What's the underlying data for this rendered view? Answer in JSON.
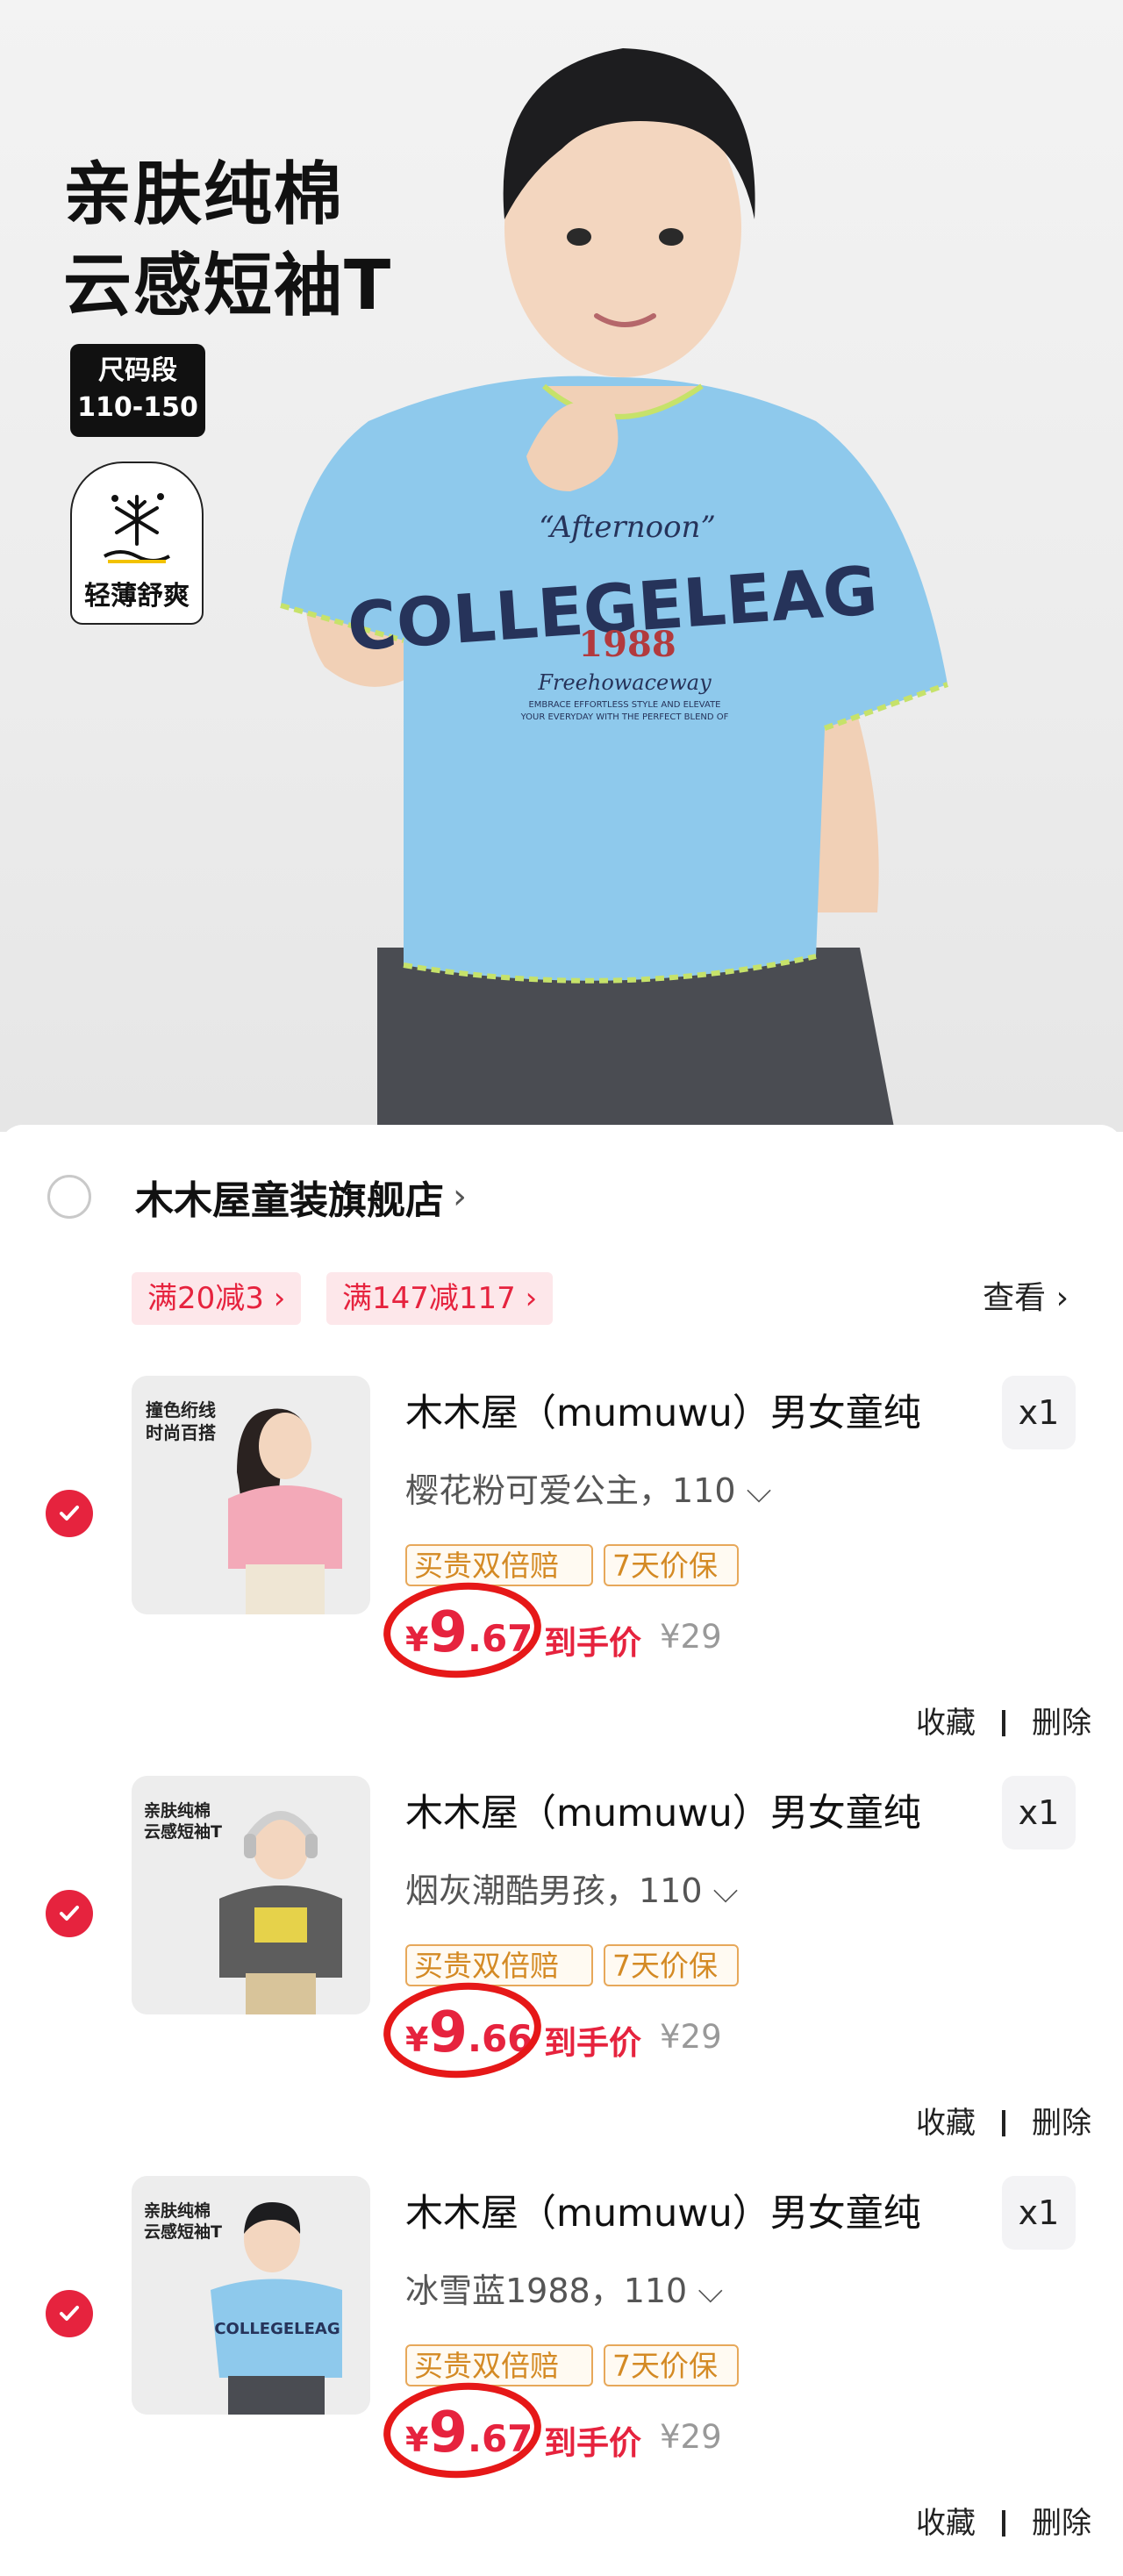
{
  "hero": {
    "title_line1": "亲肤纯棉",
    "title_line2": "云感短袖T",
    "size_label": "尺码段",
    "size_range": "110-150",
    "feature_label": "轻薄舒爽",
    "shirt": {
      "script_top": "“Afternoon”",
      "college": "COLLEGELEAG",
      "year": "1988",
      "script_bottom": "Freehowaceway",
      "small_line1": "EMBRACE EFFORTLESS STYLE AND ELEVATE",
      "small_line2": "YOUR EVERYDAY WITH THE PERFECT BLEND OF"
    }
  },
  "cart": {
    "store_name": "木木屋童装旗舰店",
    "promos": [
      "满20减3 ›",
      "满147减117 ›"
    ],
    "view_label": "查看 ›",
    "items": [
      {
        "title": "木木屋（mumuwu）男女童纯",
        "qty": "x1",
        "variant": "樱花粉可爱公主，110 ⌵",
        "tag1": "买贵双倍赔",
        "tag2": "7天价保",
        "price_currency": "¥",
        "price_int": "9",
        "price_dec": ".67",
        "final_label": "到手价",
        "orig_price": "¥29",
        "fav": "收藏",
        "del": "删除",
        "thumb_text1": "撞色绗线",
        "thumb_text2": "时尚百搭",
        "shirt_color": "#f3a9b8"
      },
      {
        "title": "木木屋（mumuwu）男女童纯",
        "qty": "x1",
        "variant": "烟灰潮酷男孩，110 ⌵",
        "tag1": "买贵双倍赔",
        "tag2": "7天价保",
        "price_currency": "¥",
        "price_int": "9",
        "price_dec": ".66",
        "final_label": "到手价",
        "orig_price": "¥29",
        "fav": "收藏",
        "del": "删除",
        "thumb_text1": "亲肤纯棉",
        "thumb_text2": "云感短袖T",
        "shirt_color": "#5d5d5d"
      },
      {
        "title": "木木屋（mumuwu）男女童纯",
        "qty": "x1",
        "variant": "冰雪蓝1988，110 ⌵",
        "tag1": "买贵双倍赔",
        "tag2": "7天价保",
        "price_currency": "¥",
        "price_int": "9",
        "price_dec": ".67",
        "final_label": "到手价",
        "orig_price": "¥29",
        "fav": "收藏",
        "del": "删除",
        "thumb_text1": "亲肤纯棉",
        "thumb_text2": "云感短袖T",
        "shirt_color": "#8ec9ec"
      }
    ]
  },
  "colors": {
    "accent": "#e6233e",
    "tag_border": "#e7a85a",
    "shirt_blue": "#8ec9ec"
  }
}
